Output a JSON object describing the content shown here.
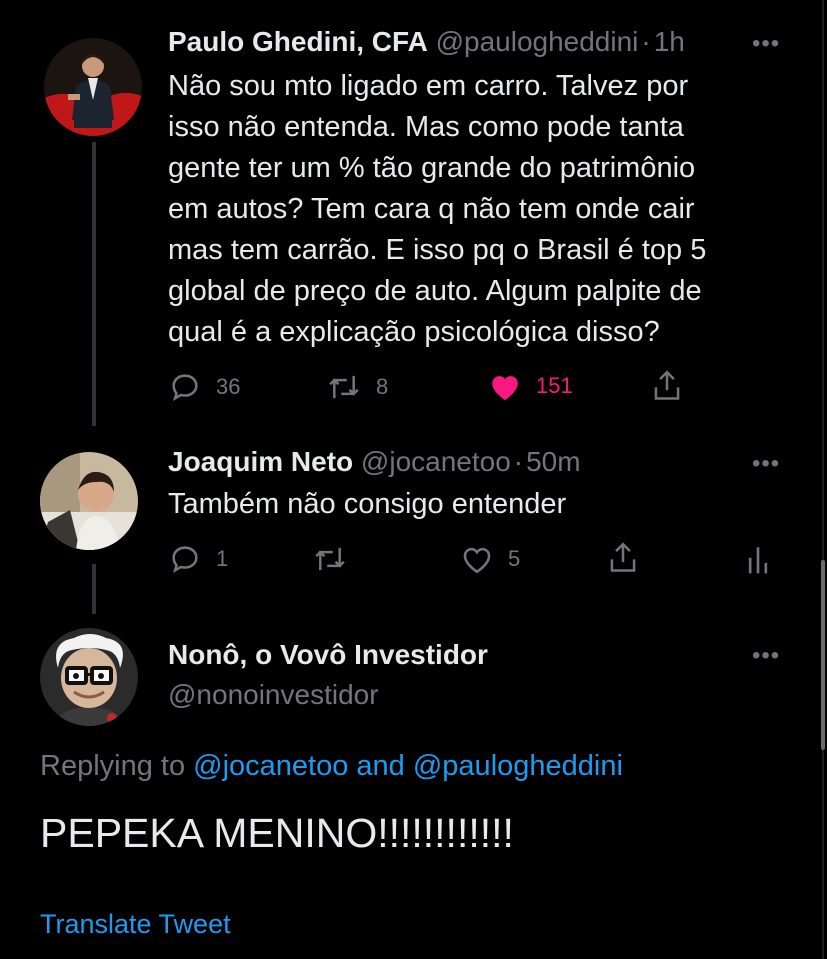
{
  "tweet1": {
    "name": "Paulo Ghedini, CFA",
    "handle": "@paulogheddini",
    "time": "1h",
    "text": "Não sou mto ligado em carro. Talvez por\nisso não entenda. Mas como pode tanta\ngente ter um % tão grande do patrimônio\nem autos? Tem cara q não tem onde cair\nmas tem carrão. E isso pq o Brasil é top 5\nglobal de preço de auto. Algum palpite de\nqual é a explicação psicológica disso?",
    "replies": "36",
    "retweets": "8",
    "likes": "151"
  },
  "tweet2": {
    "name": "Joaquim Neto",
    "handle": "@jocanetoo",
    "time": "50m",
    "text": "Também não consigo entender",
    "replies": "1",
    "likes": "5"
  },
  "tweet3": {
    "name": "Nonô, o Vovô Investidor",
    "handle": "@nonoinvestidor",
    "replying_prefix": "Replying to",
    "replying_to": "@jocanetoo and @paulogheddini",
    "text": "PEPEKA MENINO!!!!!!!!!!!!",
    "translate": "Translate Tweet"
  },
  "ui": {
    "more": "•••",
    "dot": "·"
  },
  "colors": {
    "background": "#000000",
    "text": "#e7e9ea",
    "secondary": "#71767b",
    "link": "#1d9bf0",
    "like": "#f91880"
  },
  "icons": [
    "reply-icon",
    "retweet-icon",
    "heart-icon",
    "share-icon",
    "analytics-icon",
    "more-icon"
  ]
}
